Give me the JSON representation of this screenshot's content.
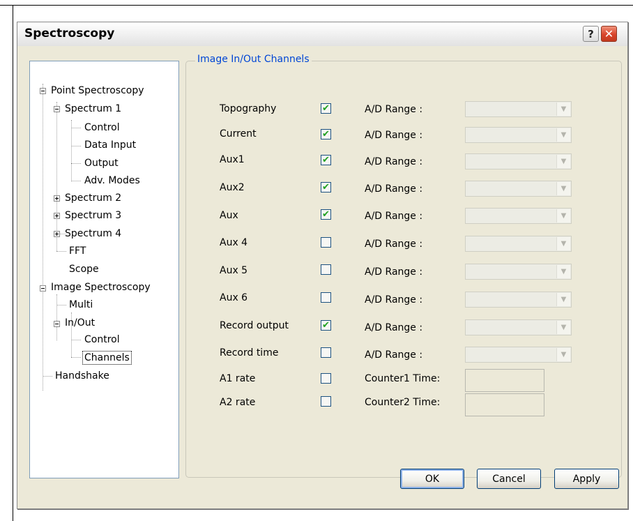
{
  "window": {
    "title": "Spectroscopy",
    "help_label": "?",
    "close_label": "✕"
  },
  "tree": {
    "point_spectroscopy": "Point Spectroscopy",
    "spectrum1": "Spectrum  1",
    "control": "Control",
    "data_input": "Data Input",
    "output": "Output",
    "adv_modes": "Adv. Modes",
    "spectrum2": "Spectrum  2",
    "spectrum3": "Spectrum  3",
    "spectrum4": "Spectrum  4",
    "fft": "FFT",
    "scope": "Scope",
    "image_spectroscopy": "Image Spectroscopy",
    "multi": "Multi",
    "inout": "In/Out",
    "inout_control": "Control",
    "channels": "Channels",
    "handshake": "Handshake"
  },
  "group": {
    "title": "Image In/Out Channels"
  },
  "channels": [
    {
      "label": "Topography",
      "checked": true,
      "mark": "✔",
      "ad_label": "A/D Range :"
    },
    {
      "label": "Current",
      "checked": true,
      "mark": "✔",
      "ad_label": "A/D Range :"
    },
    {
      "label": "Aux1",
      "checked": true,
      "mark": "✔",
      "ad_label": "A/D Range :"
    },
    {
      "label": "Aux2",
      "checked": true,
      "mark": "✔",
      "ad_label": "A/D Range :"
    },
    {
      "label": "Aux",
      "checked": true,
      "mark": "✔",
      "ad_label": "A/D Range :"
    },
    {
      "label": "Aux 4",
      "checked": false,
      "mark": "",
      "ad_label": "A/D Range :"
    },
    {
      "label": "Aux 5",
      "checked": false,
      "mark": "",
      "ad_label": "A/D Range :"
    },
    {
      "label": "Aux 6",
      "checked": false,
      "mark": "",
      "ad_label": "A/D Range :"
    },
    {
      "label": "Record output",
      "checked": true,
      "mark": "✔",
      "ad_label": "A/D Range :"
    },
    {
      "label": "Record time",
      "checked": false,
      "mark": "",
      "ad_label": "A/D Range :"
    }
  ],
  "rates": [
    {
      "label": "A1 rate",
      "checked": false,
      "mark": "",
      "counter_label": "Counter1 Time:"
    },
    {
      "label": "A2 rate",
      "checked": false,
      "mark": "",
      "counter_label": "Counter2 Time:"
    }
  ],
  "buttons": {
    "ok": "OK",
    "cancel": "Cancel",
    "apply": "Apply"
  },
  "icons": {
    "combo_arrow": "chevron-down-icon",
    "check": "checkmark-icon"
  }
}
